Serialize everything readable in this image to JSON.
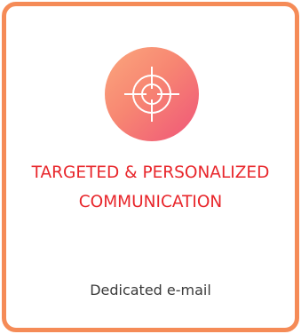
{
  "card": {
    "icon": "target-crosshair-icon",
    "title_line1": "TARGETED & PERSONALIZED",
    "title_line2": "COMMUNICATION",
    "subtitle": "Dedicated e-mail"
  },
  "colors": {
    "border": "#f58b57",
    "title": "#e8262b",
    "gradient_start": "#fba77d",
    "gradient_end": "#ef5579",
    "subtitle": "#3a3a3a"
  }
}
